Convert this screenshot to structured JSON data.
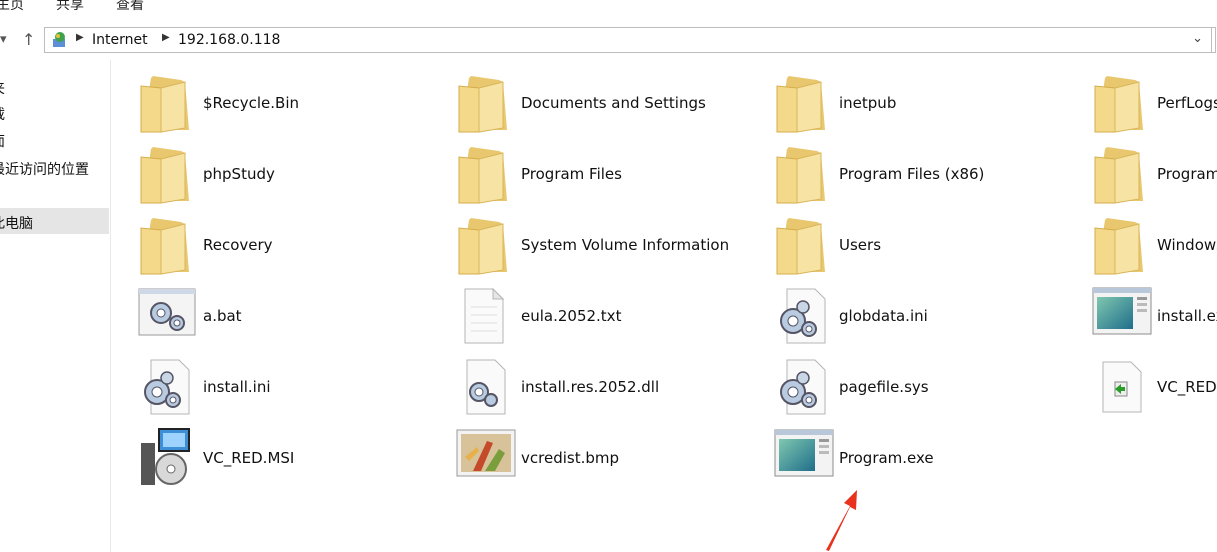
{
  "ribbon": {
    "tabs": [
      "主页",
      "共享",
      "查看"
    ]
  },
  "address": {
    "crumbs": [
      "Internet",
      "192.168.0.118"
    ],
    "dropdown_icon": "chevron-down-icon"
  },
  "sidebar": {
    "items": [
      "夹",
      "载",
      "面",
      "最近访问的位置",
      "此电脑"
    ],
    "selected": "此电脑"
  },
  "files": [
    {
      "name": "$Recycle.Bin",
      "type": "folder"
    },
    {
      "name": "Documents and Settings",
      "type": "folder"
    },
    {
      "name": "inetpub",
      "type": "folder"
    },
    {
      "name": "PerfLogs",
      "type": "folder"
    },
    {
      "name": "phpStudy",
      "type": "folder"
    },
    {
      "name": "Program Files",
      "type": "folder"
    },
    {
      "name": "Program Files (x86)",
      "type": "folder"
    },
    {
      "name": "ProgramData",
      "type": "folder"
    },
    {
      "name": "Recovery",
      "type": "folder"
    },
    {
      "name": "System Volume Information",
      "type": "folder"
    },
    {
      "name": "Users",
      "type": "folder"
    },
    {
      "name": "Windows",
      "type": "folder"
    },
    {
      "name": "a.bat",
      "type": "bat"
    },
    {
      "name": "eula.2052.txt",
      "type": "txt"
    },
    {
      "name": "globdata.ini",
      "type": "ini"
    },
    {
      "name": "install.exe",
      "type": "exe"
    },
    {
      "name": "install.ini",
      "type": "ini"
    },
    {
      "name": "install.res.2052.dll",
      "type": "dll"
    },
    {
      "name": "pagefile.sys",
      "type": "ini"
    },
    {
      "name": "VC_RED.cab",
      "type": "cab"
    },
    {
      "name": "VC_RED.MSI",
      "type": "msi"
    },
    {
      "name": "vcredist.bmp",
      "type": "bmp"
    },
    {
      "name": "Program.exe",
      "type": "exe"
    }
  ],
  "annotation": {
    "color": "#e8321e"
  }
}
